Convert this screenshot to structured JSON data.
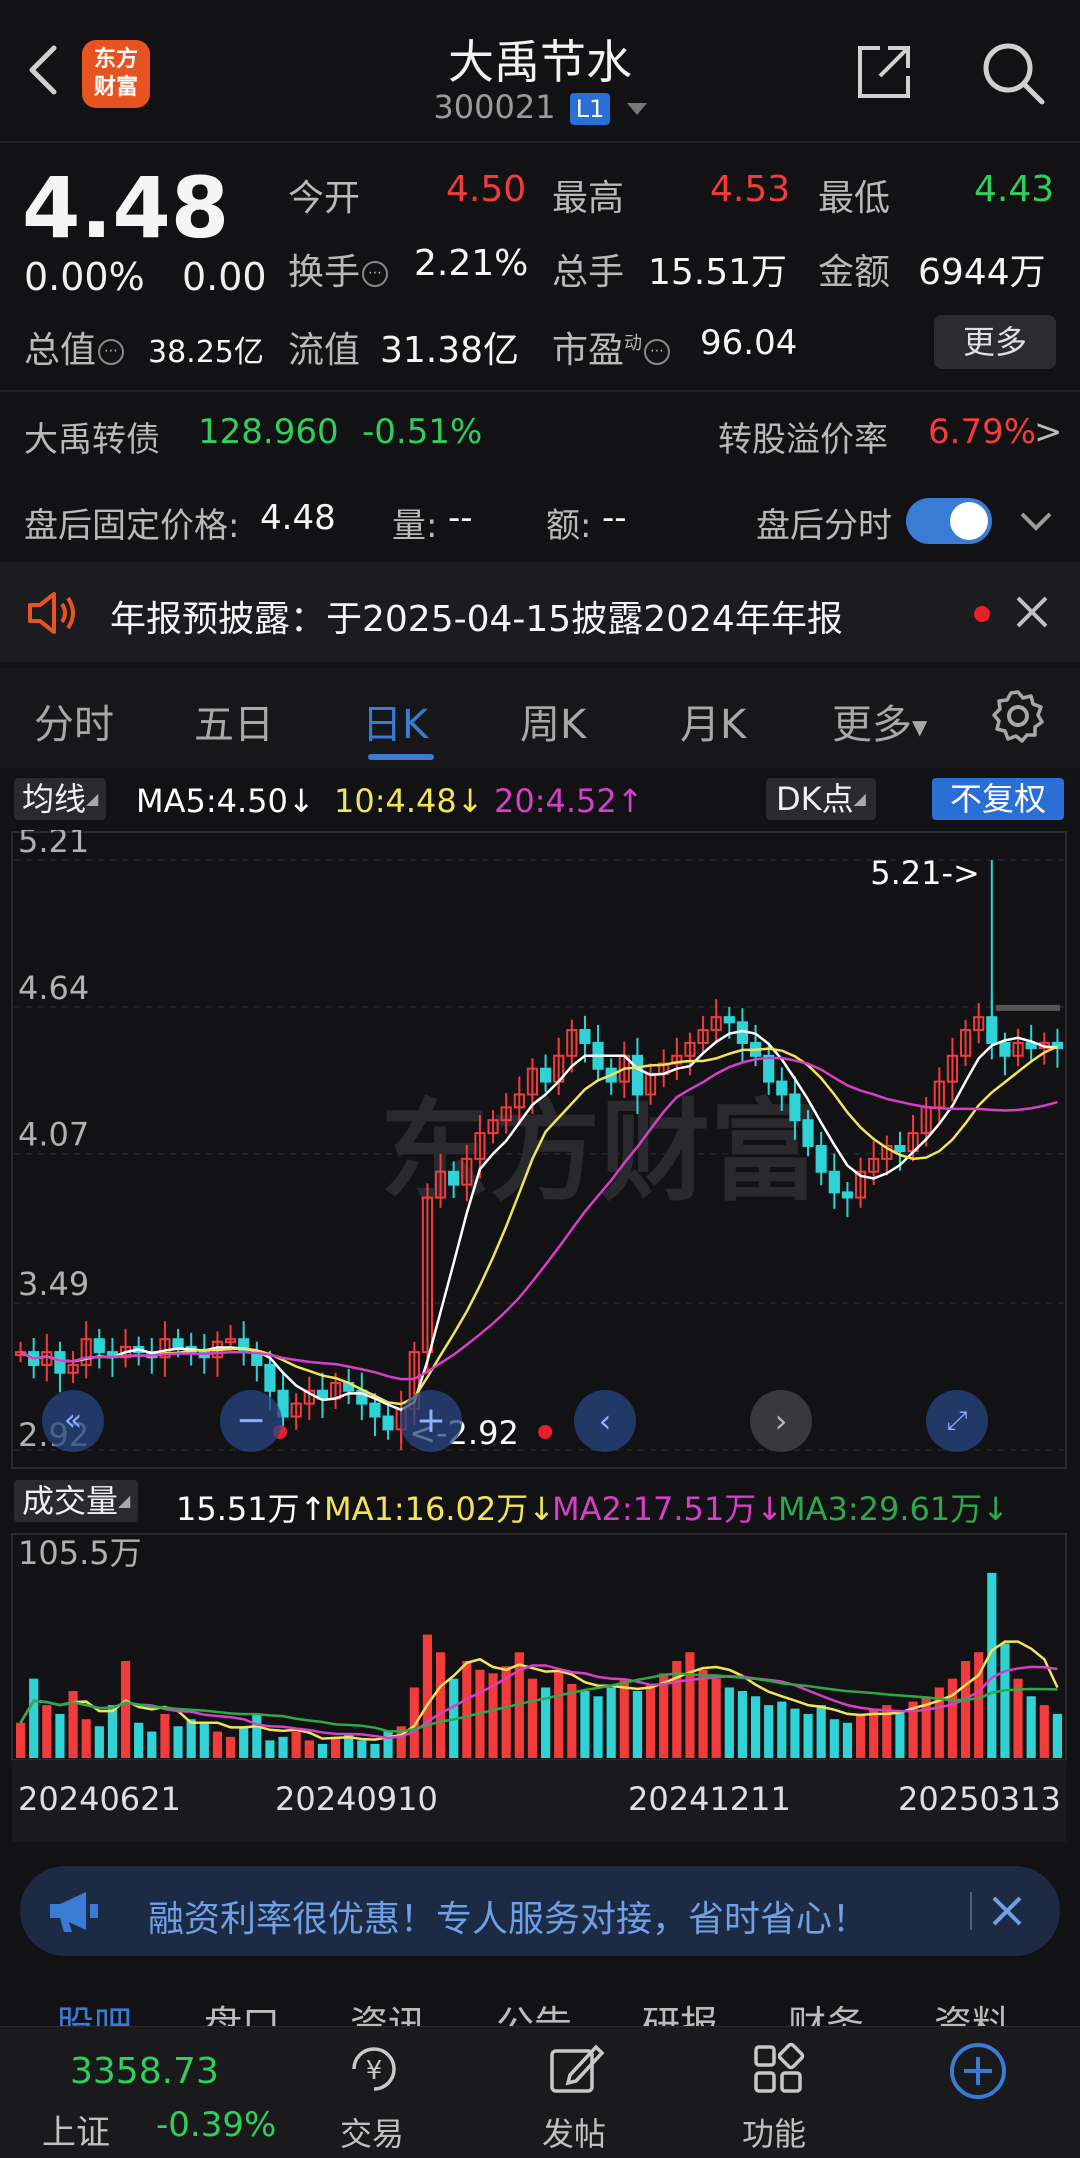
{
  "header": {
    "title": "大禹节水",
    "code": "300021",
    "level_badge": "L1",
    "logo_line1": "东方",
    "logo_line2": "财富"
  },
  "quote": {
    "price": "4.48",
    "change_pct": "0.00%",
    "change": "0.00",
    "open_label": "今开",
    "open": "4.50",
    "high_label": "最高",
    "high": "4.53",
    "low_label": "最低",
    "low": "4.43",
    "turnover_label": "换手",
    "turnover": "2.21%",
    "volume_label": "总手",
    "volume": "15.51万",
    "amount_label": "金额",
    "amount": "6944万",
    "mktcap_label": "总值",
    "mktcap": "38.25亿",
    "float_label": "流值",
    "float": "31.38亿",
    "pe_label": "市盈",
    "pe_sup": "动",
    "pe": "96.04",
    "more_button": "更多"
  },
  "bond": {
    "name": "大禹转债",
    "price": "128.960",
    "change": "-0.51%",
    "premium_label": "转股溢价率",
    "premium": "6.79%",
    "arrow": ">"
  },
  "after_hours": {
    "price_label": "盘后固定价格:",
    "price": "4.48",
    "vol_label": "量:",
    "vol": "--",
    "amt_label": "额:",
    "amt": "--",
    "toggle_label": "盘后分时",
    "toggle_on": true
  },
  "notice": {
    "text": "年报预披露：于2025-04-15披露2024年年报"
  },
  "tabs": [
    {
      "label": "分时",
      "active": false
    },
    {
      "label": "五日",
      "active": false
    },
    {
      "label": "日K",
      "active": true
    },
    {
      "label": "周K",
      "active": false
    },
    {
      "label": "月K",
      "active": false
    },
    {
      "label": "更多",
      "active": false
    }
  ],
  "kline": {
    "ma_selector": "均线",
    "ma5": "MA5:4.50",
    "ma10": "10:4.48",
    "ma20": "20:4.52",
    "dk_button": "DK点",
    "adjust_button": "不复权",
    "y_labels": [
      "5.21",
      "4.64",
      "4.07",
      "3.49",
      "2.92"
    ],
    "max_marker": "5.21->",
    "min_marker": "<-2.92"
  },
  "volume": {
    "selector": "成交量",
    "value": "15.51万",
    "ma1": "MA1:16.02万",
    "ma2": "MA2:17.51万",
    "ma3": "MA3:29.61万",
    "y_label": "105.5万",
    "dates": [
      "20240621",
      "20240910",
      "20241211",
      "20250313"
    ]
  },
  "promo": {
    "text": "融资利率很优惠！专人服务对接，省时省心！"
  },
  "sub_tabs": [
    "股吧",
    "盘口",
    "资讯",
    "公告",
    "研报",
    "财务",
    "资料"
  ],
  "bottom_bar": {
    "index_value": "3358.73",
    "index_name": "上证",
    "index_change": "-0.39%",
    "items": [
      "交易",
      "发帖",
      "功能"
    ]
  },
  "colors": {
    "up": "#f23b3b",
    "down": "#2fd3d6",
    "accent": "#3a7bd5",
    "ma5": "#ffffff",
    "ma10": "#f2e45a",
    "ma20": "#d63fc8",
    "vol_ma3": "#2fa84b"
  },
  "chart_data": [
    {
      "type": "candlestick",
      "title": "日K",
      "ylim": [
        2.92,
        5.21
      ],
      "y_ticks": [
        5.21,
        4.64,
        4.07,
        3.49,
        2.92
      ],
      "x_dates": [
        "20240621",
        "20240910",
        "20241211",
        "20250313"
      ],
      "max": 5.21,
      "min": 2.92,
      "series": [
        {
          "name": "MA5",
          "last": 4.5
        },
        {
          "name": "MA10",
          "last": 4.48
        },
        {
          "name": "MA20",
          "last": 4.52
        }
      ],
      "close_path": [
        3.3,
        3.25,
        3.3,
        3.22,
        3.25,
        3.35,
        3.3,
        3.28,
        3.32,
        3.3,
        3.28,
        3.35,
        3.32,
        3.3,
        3.28,
        3.34,
        3.35,
        3.3,
        3.25,
        3.15,
        3.05,
        3.1,
        3.15,
        3.12,
        3.18,
        3.15,
        3.1,
        3.05,
        3.0,
        3.08,
        3.3,
        3.9,
        4.0,
        3.95,
        4.05,
        4.15,
        4.2,
        4.25,
        4.3,
        4.4,
        4.35,
        4.45,
        4.55,
        4.5,
        4.4,
        4.35,
        4.45,
        4.3,
        4.38,
        4.42,
        4.45,
        4.5,
        4.55,
        4.6,
        4.58,
        4.5,
        4.45,
        4.35,
        4.3,
        4.2,
        4.1,
        4.0,
        3.92,
        3.9,
        4.0,
        4.05,
        4.1,
        4.08,
        4.15,
        4.25,
        4.35,
        4.45,
        4.55,
        4.6,
        4.5,
        4.45,
        4.5,
        4.48,
        4.5,
        4.48
      ]
    },
    {
      "type": "bar",
      "title": "成交量",
      "ylim": [
        0,
        105.5
      ],
      "unit": "万",
      "last": 15.51,
      "series": [
        {
          "name": "MA1",
          "last": 16.02
        },
        {
          "name": "MA2",
          "last": 17.51
        },
        {
          "name": "MA3",
          "last": 29.61
        }
      ],
      "values": [
        20,
        45,
        30,
        25,
        38,
        22,
        18,
        30,
        55,
        20,
        15,
        25,
        18,
        22,
        20,
        15,
        12,
        18,
        25,
        10,
        12,
        15,
        10,
        8,
        12,
        14,
        10,
        8,
        15,
        18,
        40,
        70,
        60,
        45,
        55,
        50,
        48,
        52,
        60,
        45,
        40,
        50,
        42,
        38,
        35,
        40,
        45,
        38,
        42,
        48,
        55,
        60,
        50,
        45,
        40,
        38,
        35,
        30,
        32,
        28,
        25,
        30,
        22,
        20,
        25,
        28,
        30,
        26,
        32,
        35,
        40,
        45,
        55,
        60,
        105,
        65,
        45,
        35,
        30,
        25
      ]
    }
  ]
}
